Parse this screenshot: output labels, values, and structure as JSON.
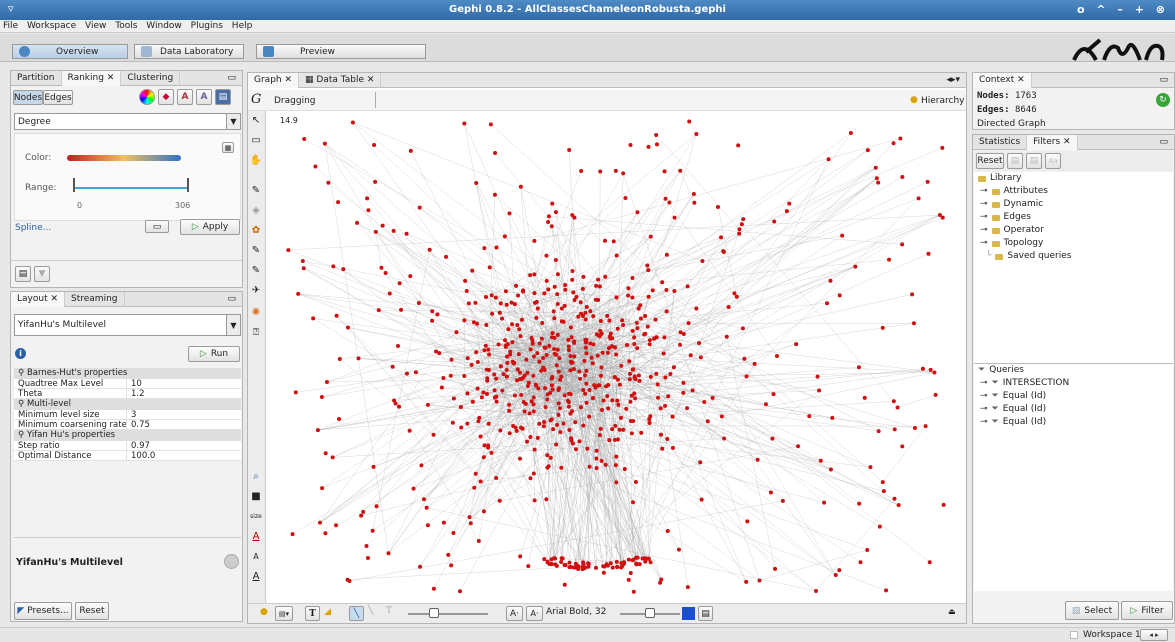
{
  "window": {
    "title": "Gephi 0.8.2 - AllClassesChameleonRobusta.gephi",
    "controls": "o ^ – + ⊗"
  },
  "menu": [
    "File",
    "Workspace",
    "View",
    "Tools",
    "Window",
    "Plugins",
    "Help"
  ],
  "modes": {
    "overview": "Overview",
    "datalab": "Data Laboratory",
    "preview": "Preview"
  },
  "ranking": {
    "tabs": [
      "Partition",
      "Ranking",
      "Clustering"
    ],
    "subtabs": [
      "Nodes",
      "Edges"
    ],
    "attribute": "Degree",
    "color_label": "Color:",
    "range_label": "Range:",
    "range_min": "0",
    "range_max": "306",
    "spline": "Spline...",
    "apply": "Apply"
  },
  "layout": {
    "tabs": [
      "Layout",
      "Streaming"
    ],
    "algorithm": "YifanHu's Multilevel",
    "run": "Run",
    "sections": [
      {
        "title": "Barnes-Hut's properties",
        "props": [
          {
            "k": "Quadtree Max Level",
            "v": "10"
          },
          {
            "k": "Theta",
            "v": "1.2"
          }
        ]
      },
      {
        "title": "Multi-level",
        "props": [
          {
            "k": "Minimum level size",
            "v": "3"
          },
          {
            "k": "Minimum coarsening rate",
            "v": "0.75"
          }
        ]
      },
      {
        "title": "Yifan Hu's properties",
        "props": [
          {
            "k": "Step ratio",
            "v": "0.97"
          },
          {
            "k": "Optimal Distance",
            "v": "100.0"
          }
        ]
      }
    ],
    "footer_name": "YifanHu's Multilevel",
    "presets": "Presets...",
    "reset": "Reset"
  },
  "graph": {
    "tabs": [
      "Graph",
      "Data Table"
    ],
    "mode": "Dragging",
    "hierarchy": "Hierarchy",
    "scale": "14.9",
    "font_label": "Arial Bold, 32",
    "node_color": "#d01010",
    "edge_color": "#9a9a9a",
    "text_tools": [
      "T",
      "size",
      "A",
      "A",
      "A"
    ]
  },
  "context": {
    "tab": "Context",
    "nodes_label": "Nodes:",
    "nodes": "1763",
    "edges_label": "Edges:",
    "edges": "8646",
    "type": "Directed Graph"
  },
  "filters": {
    "tabs": [
      "Statistics",
      "Filters"
    ],
    "reset": "Reset",
    "library": "Library",
    "items": [
      "Attributes",
      "Dynamic",
      "Edges",
      "Operator",
      "Topology"
    ],
    "saved": "Saved queries",
    "queries_label": "Queries",
    "queries": [
      "INTERSECTION",
      "Equal (Id)",
      "Equal (Id)",
      "Equal (Id)"
    ],
    "select": "Select",
    "filter": "Filter"
  },
  "status": {
    "workspace": "Workspace 1"
  },
  "colors": {
    "accent": "#3b79b8",
    "node": "#d01010"
  }
}
